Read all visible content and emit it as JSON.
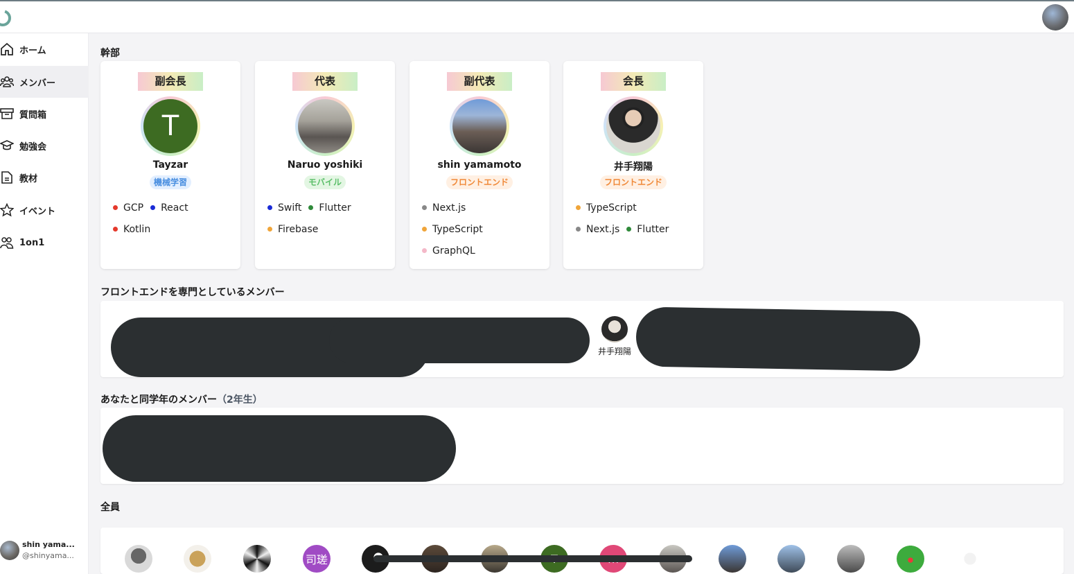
{
  "header": {
    "logo_icon": "circle-logo-icon",
    "user_avatar_icon": "user-avatar-icon"
  },
  "sidebar": {
    "items": [
      {
        "label": "ホーム",
        "icon": "home-icon"
      },
      {
        "label": "メンバー",
        "icon": "users-icon",
        "active": true
      },
      {
        "label": "質問箱",
        "icon": "inbox-icon"
      },
      {
        "label": "勉強会",
        "icon": "graduation-cap-icon"
      },
      {
        "label": "教材",
        "icon": "document-icon"
      },
      {
        "label": "イベント",
        "icon": "star-icon"
      },
      {
        "label": "1on1",
        "icon": "two-people-icon"
      }
    ],
    "user": {
      "name": "shin yama...",
      "handle": "@shinyama..."
    }
  },
  "executives": {
    "title": "幹部",
    "cards": [
      {
        "role": "副会長",
        "name": "Tayzar",
        "avatar_letter": "T",
        "specialty": "機械学習",
        "skills": [
          [
            "GCP",
            "React"
          ],
          [
            "Kotlin"
          ]
        ]
      },
      {
        "role": "代表",
        "name": "Naruo yoshiki",
        "specialty": "モバイル",
        "skills": [
          [
            "Swift",
            "Flutter"
          ],
          [
            "Firebase"
          ]
        ]
      },
      {
        "role": "副代表",
        "name": "shin yamamoto",
        "specialty": "フロントエンド",
        "skills": [
          [
            "Next.js"
          ],
          [
            "TypeScript"
          ],
          [
            "GraphQL"
          ]
        ]
      },
      {
        "role": "会長",
        "name": "井手翔陽",
        "specialty": "フロントエンド",
        "skills": [
          [
            "TypeScript"
          ],
          [
            "Next.js",
            "Flutter"
          ]
        ]
      }
    ]
  },
  "colors": {
    "GCP": "#e5392c",
    "React": "#1a2bd6",
    "Kotlin": "#e5392c",
    "Swift": "#1a2bd6",
    "Flutter": "#2f8a3a",
    "Firebase": "#f0a53a",
    "Next.js": "#888888",
    "TypeScript": "#f0a53a",
    "GraphQL": "#f4b8c8",
    "spec_ml_bg": "#e3efff",
    "spec_ml_fg": "#4a8fe0",
    "spec_mobile_bg": "#e3f6e3",
    "spec_mobile_fg": "#5cbf6a",
    "spec_front_bg": "#fff0e3",
    "spec_front_fg": "#f08a3a"
  },
  "frontend_section": {
    "title": "フロントエンドを専門としているメンバー",
    "visible_member": "井手翔陽"
  },
  "same_grade_section": {
    "title": "あなたと同学年のメンバー",
    "grade": "（2年生）"
  },
  "all_section": {
    "title": "全員",
    "avatars": [
      {
        "icon": "robot-avatar-icon"
      },
      {
        "icon": "figurine-avatar-icon"
      },
      {
        "icon": "swirl-avatar-icon"
      },
      {
        "text": "司瑳"
      },
      {
        "icon": "silhouette-avatar-icon"
      },
      {
        "icon": "photo-avatar-icon"
      },
      {
        "icon": "photo-avatar-icon"
      },
      {
        "text": "T"
      },
      {
        "text": "m"
      },
      {
        "icon": "photo-avatar-icon"
      },
      {
        "icon": "photo-avatar-icon"
      },
      {
        "icon": "photo-avatar-icon"
      },
      {
        "icon": "photo-avatar-icon"
      },
      {
        "icon": "frog-avatar-icon"
      },
      {
        "icon": "cat-avatar-icon"
      }
    ]
  }
}
